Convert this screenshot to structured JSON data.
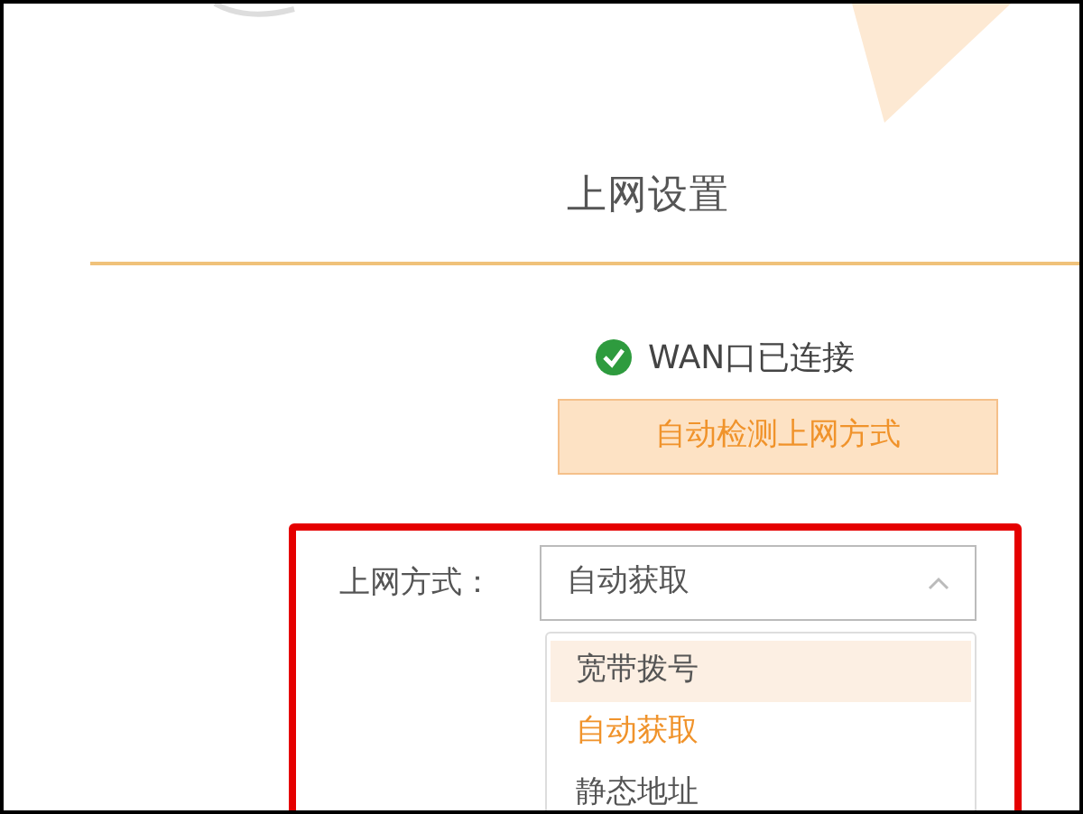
{
  "title": "上网设置",
  "status": {
    "text": "WAN口已连接",
    "connected": true
  },
  "detect_button": "自动检测上网方式",
  "connection_type": {
    "label": "上网方式：",
    "value": "自动获取",
    "expanded": true,
    "options": [
      {
        "label": "宽带拨号",
        "selected": false,
        "highlighted": true
      },
      {
        "label": "自动获取",
        "selected": true,
        "highlighted": false
      },
      {
        "label": "静态地址",
        "selected": false,
        "highlighted": false
      }
    ]
  }
}
